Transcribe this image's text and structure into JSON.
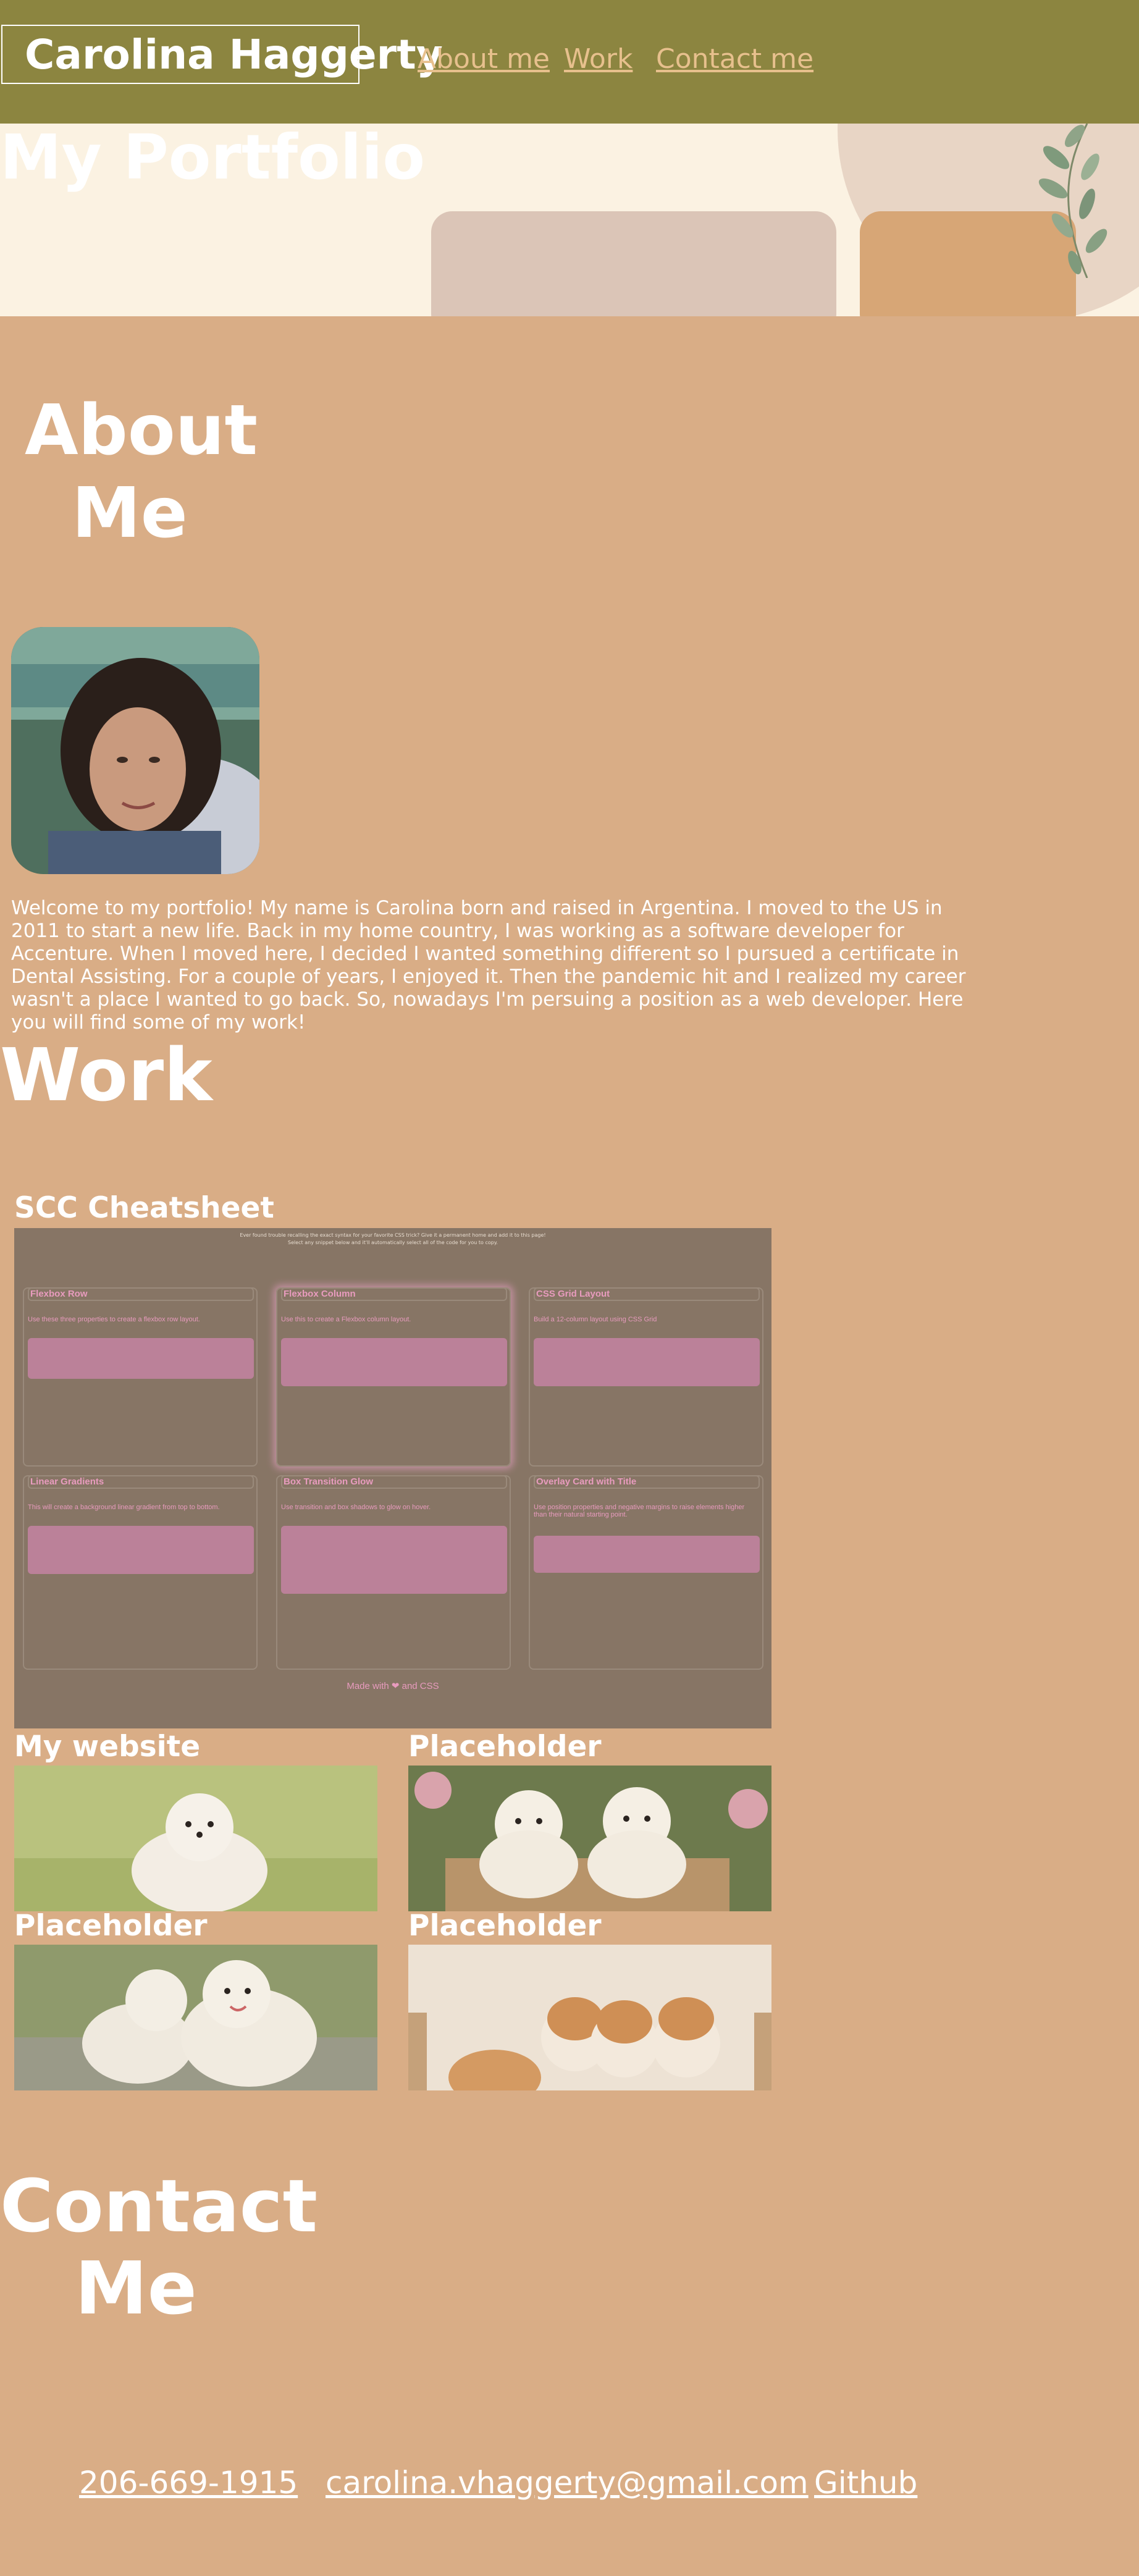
{
  "header": {
    "name": "Carolina Haggerty",
    "nav": [
      "About me",
      "Work",
      "Contact me"
    ]
  },
  "hero": {
    "title": "My Portfolio"
  },
  "about": {
    "title_line1": "About",
    "title_line2": "Me",
    "text": "Welcome to my portfolio! My name is Carolina born and raised in Argentina. I moved to the US in 2011 to start a new life. Back in my home country, I was working as a software developer for Accenture. When I moved here, I decided I wanted something different so I pursued a certificate in Dental Assisting. For a couple of years, I enjoyed it. Then the pandemic hit and I realized my career wasn't a place I wanted to go back. So, nowadays I'm persuing a position as a web developer. Here you will find some of my work!"
  },
  "work": {
    "title": "Work",
    "projects": [
      {
        "title": "SCC Cheatsheet"
      },
      {
        "title": "My website"
      },
      {
        "title": "Placeholder"
      },
      {
        "title": "Placeholder"
      },
      {
        "title": "Placeholder"
      }
    ],
    "cheatsheet": {
      "intro_line1": "Ever found trouble recalling the exact syntax for your favorite CSS trick? Give it a permanent home and add it to this page!",
      "intro_line2": "Select any snippet below and it'll automatically select all of the code for you to copy.",
      "cards": [
        {
          "title": "Flexbox Row",
          "desc": "Use these three properties to create a flexbox row layout."
        },
        {
          "title": "Flexbox Column",
          "desc": "Use this to create a Flexbox column layout."
        },
        {
          "title": "CSS Grid Layout",
          "desc": "Build a 12-column layout using CSS Grid"
        },
        {
          "title": "Linear Gradients",
          "desc": "This will create a background linear gradient from top to bottom."
        },
        {
          "title": "Box Transition Glow",
          "desc": "Use transition and box shadows to glow on hover."
        },
        {
          "title": "Overlay Card with Title",
          "desc": "Use position properties and negative margins to raise elements higher than their natural starting point."
        }
      ],
      "footer": "Made with ❤ and CSS"
    }
  },
  "contact": {
    "title_line1": "Contact",
    "title_line2": "Me",
    "phone": "206-669-1915",
    "email": "carolina.vhaggerty@gmail.com",
    "github": "Github"
  },
  "colors": {
    "header_bg": "#8c8540",
    "page_bg": "#d9ad86",
    "hero_bg": "#fbf2e2",
    "nav_link": "#e7c08d",
    "cheatsheet_bg": "#877565",
    "cheatsheet_accent": "#e89bbe"
  }
}
